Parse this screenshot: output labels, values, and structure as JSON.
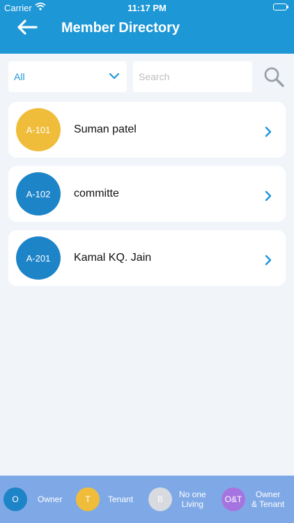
{
  "status_bar": {
    "carrier": "Carrier",
    "time": "11:17 PM"
  },
  "header": {
    "title": "Member Directory"
  },
  "filter": {
    "selected": "All"
  },
  "search": {
    "placeholder": "Search"
  },
  "members": [
    {
      "unit": "A-101",
      "name": "Suman patel",
      "color": "#f0bd3a"
    },
    {
      "unit": "A-102",
      "name": "committe",
      "color": "#1e84c8"
    },
    {
      "unit": "A-201",
      "name": "Kamal KQ. Jain",
      "color": "#1e84c8"
    }
  ],
  "legend": [
    {
      "code": "O",
      "label": "Owner",
      "color": "#1e84c8"
    },
    {
      "code": "T",
      "label": "Tenant",
      "color": "#f0bd3a"
    },
    {
      "code": "B",
      "label": "No one\nLiving",
      "color": "#d7dbe0"
    },
    {
      "code": "O&T",
      "label": "Owner\n& Tenant",
      "color": "#a674e0"
    }
  ],
  "icons": {
    "back": "arrow-left-icon",
    "dropdown": "chevron-down-icon",
    "search": "search-icon",
    "row": "chevron-right-icon"
  }
}
